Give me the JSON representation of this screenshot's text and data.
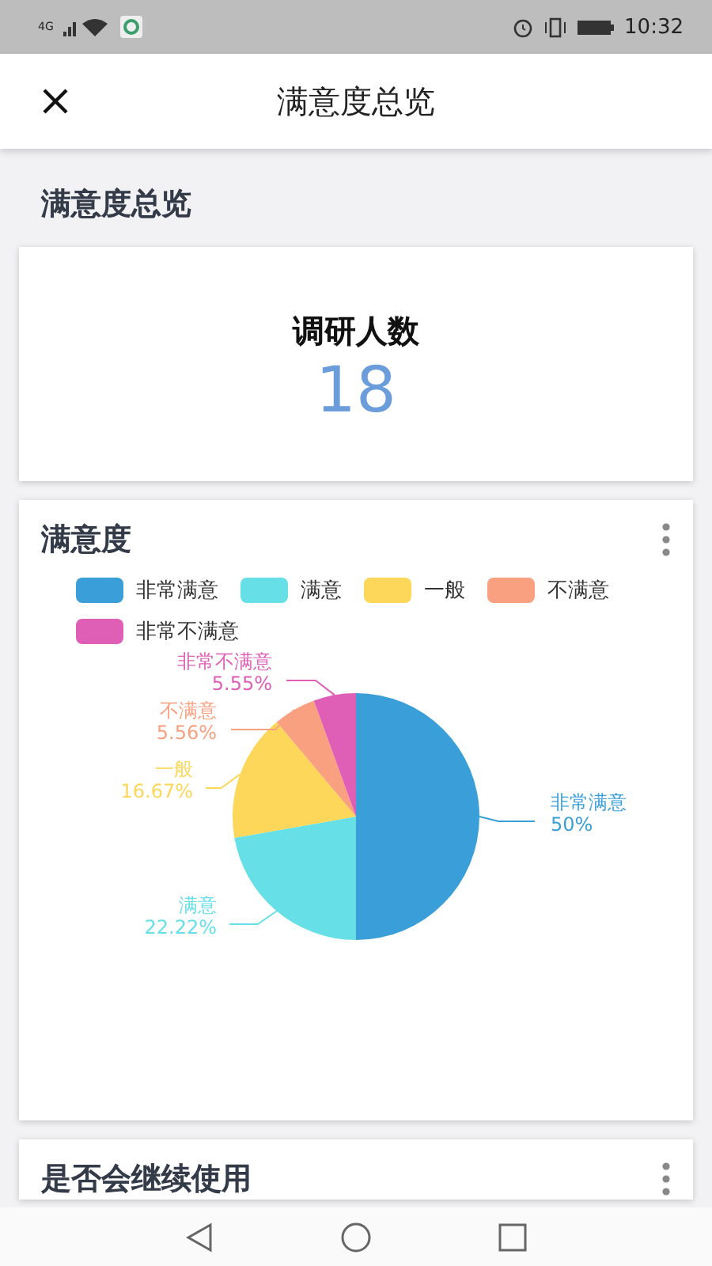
{
  "status_bar": {
    "network": "4G",
    "time": "10:32"
  },
  "app_bar": {
    "title": "满意度总览"
  },
  "section_title": "满意度总览",
  "summary_card": {
    "label": "调研人数",
    "value": "18"
  },
  "satisfaction_card": {
    "title": "满意度",
    "chart_data": {
      "type": "pie",
      "categories": [
        "非常满意",
        "满意",
        "一般",
        "不满意",
        "非常不满意"
      ],
      "series": [
        {
          "values": [
            50,
            22.22,
            16.67,
            5.56,
            5.55
          ],
          "colors": [
            "#3a9fd8",
            "#66dfe6",
            "#fcd75a",
            "#f9a081",
            "#de5fb5"
          ]
        }
      ],
      "value_labels": [
        "50%",
        "22.22%",
        "16.67%",
        "5.56%",
        "5.55%"
      ]
    }
  },
  "next_card": {
    "title": "是否会继续使用"
  }
}
